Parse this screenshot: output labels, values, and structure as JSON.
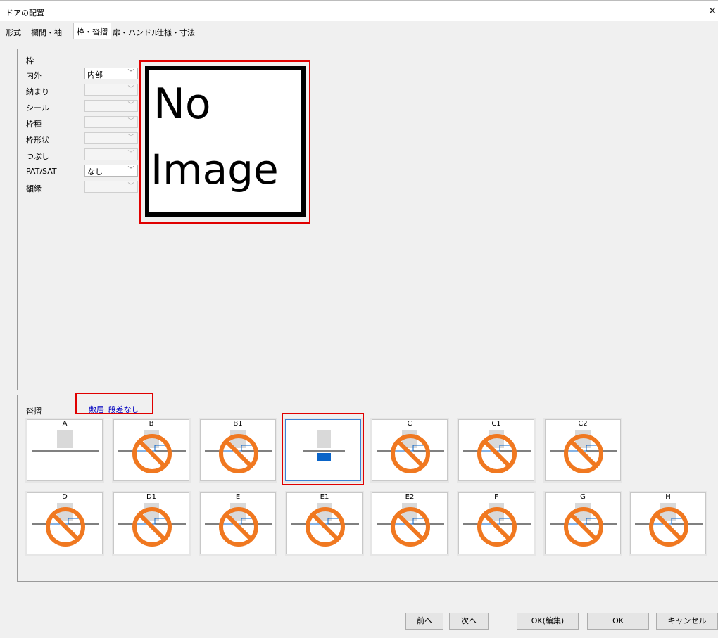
{
  "window": {
    "title": "ドアの配置"
  },
  "tabs": [
    {
      "label": "形式"
    },
    {
      "label": "欄間・袖"
    },
    {
      "label": "枠・沓摺"
    },
    {
      "label": "扉・ハンドル"
    },
    {
      "label": "仕様・寸法"
    }
  ],
  "frame": {
    "section_label": "枠",
    "fields": [
      {
        "label": "内外",
        "value": "内部",
        "enabled": true
      },
      {
        "label": "納まり",
        "value": "",
        "enabled": false
      },
      {
        "label": "シール",
        "value": "",
        "enabled": false
      },
      {
        "label": "枠種",
        "value": "",
        "enabled": false
      },
      {
        "label": "枠形状",
        "value": "",
        "enabled": false
      },
      {
        "label": "つぶし",
        "value": "",
        "enabled": false
      },
      {
        "label": "PAT/SAT",
        "value": "なし",
        "enabled": true
      },
      {
        "label": "額縁",
        "value": "",
        "enabled": false
      }
    ],
    "preview": {
      "line1": "No",
      "line2": "Image"
    }
  },
  "kamachi": {
    "section_label": "沓摺",
    "selected_value": "敷居_段差なし",
    "options": [
      {
        "label": "A",
        "available": true
      },
      {
        "label": "B",
        "available": false
      },
      {
        "label": "B1",
        "available": false
      },
      {
        "label": "",
        "available": true,
        "selected": true
      },
      {
        "label": "C",
        "available": false
      },
      {
        "label": "C1",
        "available": false
      },
      {
        "label": "C2",
        "available": false
      },
      {
        "label": "D",
        "available": false
      },
      {
        "label": "D1",
        "available": false
      },
      {
        "label": "E",
        "available": false
      },
      {
        "label": "E1",
        "available": false
      },
      {
        "label": "E2",
        "available": false
      },
      {
        "label": "F",
        "available": false
      },
      {
        "label": "G",
        "available": false
      },
      {
        "label": "H",
        "available": false
      }
    ]
  },
  "buttons": {
    "prev": "前へ",
    "next": "次へ",
    "ok_edit": "OK(編集)",
    "ok": "OK",
    "cancel": "キャンセル"
  },
  "colors": {
    "highlight": "#e00000",
    "prohibited": "#f07820",
    "selection_blue": "#0a64c8",
    "link_text": "#0000c0"
  }
}
